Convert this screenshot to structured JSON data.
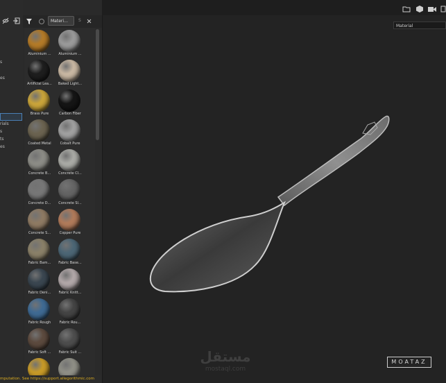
{
  "shelf": {
    "search_tab": "Materi…",
    "search_prefix": "S",
    "materials": [
      {
        "label": "Aluminium ...",
        "color": "#b37a28"
      },
      {
        "label": "Aluminium ...",
        "color": "#9a9a9a"
      },
      {
        "label": "Artificial Lea...",
        "color": "#1e1e1e"
      },
      {
        "label": "Baked Light...",
        "color": "#c8b7a2"
      },
      {
        "label": "Brass Pure",
        "color": "#c9a43a"
      },
      {
        "label": "Carbon Fiber",
        "color": "#151515"
      },
      {
        "label": "Coated Metal",
        "color": "#6b6350"
      },
      {
        "label": "Cobalt Pure",
        "color": "#a0a0a0"
      },
      {
        "label": "Concrete B...",
        "color": "#8c8c86"
      },
      {
        "label": "Concrete Cl...",
        "color": "#a9aaa5"
      },
      {
        "label": "Concrete D...",
        "color": "#777"
      },
      {
        "label": "Concrete Sl...",
        "color": "#646464"
      },
      {
        "label": "Concrete S...",
        "color": "#8e7a63"
      },
      {
        "label": "Copper Pure",
        "color": "#b07a5a"
      },
      {
        "label": "Fabric Bam...",
        "color": "#8a8068"
      },
      {
        "label": "Fabric Base...",
        "color": "#4c6675"
      },
      {
        "label": "Fabric Deni...",
        "color": "#3a4650"
      },
      {
        "label": "Fabric Knitt...",
        "color": "#b1a7a8"
      },
      {
        "label": "Fabric Rough",
        "color": "#3f6a93"
      },
      {
        "label": "Fabric Rou...",
        "color": "#444"
      },
      {
        "label": "Fabric Soft ...",
        "color": "#5c4a3e"
      },
      {
        "label": "Fabric Suit ...",
        "color": "#4d4d4d"
      },
      {
        "label": "",
        "color": "#c79a28"
      },
      {
        "label": "",
        "color": "#8f8f86"
      }
    ]
  },
  "tree": {
    "items": [
      "",
      "s",
      "es",
      "",
      "",
      "rials",
      "s",
      "ts",
      "es"
    ]
  },
  "viewport": {
    "mode": "Material"
  },
  "status": {
    "message": "mputation. See https://support.allegorithmic.com"
  },
  "watermark": {
    "brand": "MOATAZ",
    "arabic": "مستقل",
    "url": "mostaql.com"
  }
}
